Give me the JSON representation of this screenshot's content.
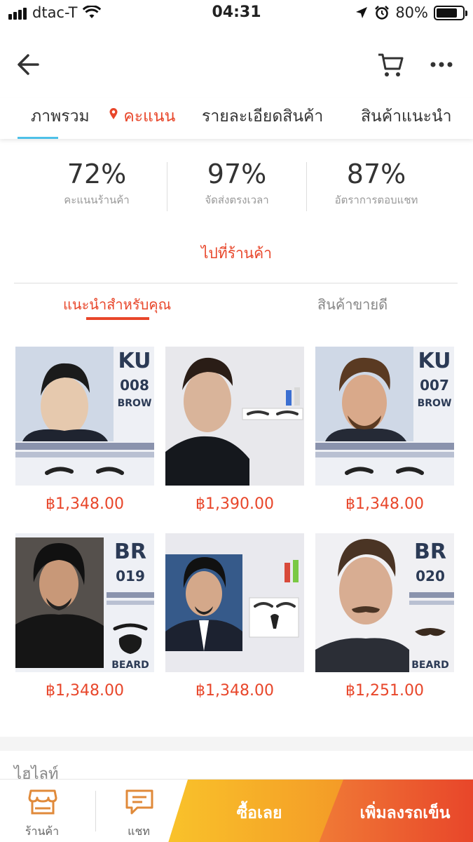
{
  "status_bar": {
    "carrier": "dtac-T",
    "time": "04:31",
    "battery": "80%",
    "battery_level": 0.8
  },
  "tabs": [
    {
      "label": "ภาพรวม"
    },
    {
      "label": "คะแนน"
    },
    {
      "label": "รายละเอียดสินค้า"
    },
    {
      "label": "สินค้าแนะนำ"
    }
  ],
  "stats": [
    {
      "value": "72%",
      "label": "คะแนนร้านค้า"
    },
    {
      "value": "97%",
      "label": "จัดส่งตรงเวลา"
    },
    {
      "value": "87%",
      "label": "อัตราการตอบแชท"
    }
  ],
  "goto_shop": "ไปที่ร้านค้า",
  "sub_tabs": [
    {
      "label": "แนะนำสำหรับคุณ"
    },
    {
      "label": "สินค้าขายดี"
    }
  ],
  "products": [
    {
      "price": "฿1,348.00",
      "badge": [
        "KU",
        "008",
        "BROW"
      ]
    },
    {
      "price": "฿1,390.00"
    },
    {
      "price": "฿1,348.00",
      "badge": [
        "KU",
        "007",
        "BROW"
      ]
    },
    {
      "price": "฿1,348.00",
      "badge": [
        "BR",
        "019",
        "BEARD"
      ]
    },
    {
      "price": "฿1,348.00"
    },
    {
      "price": "฿1,251.00",
      "badge": [
        "BR",
        "020",
        "BEARD"
      ]
    }
  ],
  "highlights_label": "ไฮไลท์",
  "bottom_bar": {
    "shop_label": "ร้านค้า",
    "chat_label": "แชท",
    "buy_now": "ซื้อเลย",
    "add_to_cart": "เพิ่มลงรถเข็น"
  },
  "colors": {
    "accent": "#e8462a",
    "tab_indicator": "#4ec0e8",
    "buy_now": "#f6b02a",
    "badge_text": "#2b3a55"
  },
  "icons": [
    "back-arrow-icon",
    "cart-icon",
    "more-dots-icon",
    "location-pin-icon",
    "wifi-icon",
    "location-arrow-icon",
    "alarm-icon",
    "store-icon",
    "chat-icon"
  ]
}
